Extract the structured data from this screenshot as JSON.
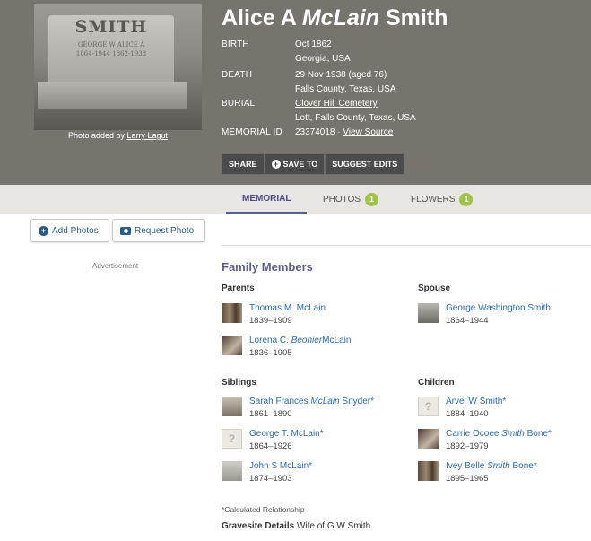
{
  "header": {
    "first_name": "Alice A",
    "middle_name": "McLain",
    "last_name": "Smith",
    "photo_credit_prefix": "Photo added by",
    "photo_credit_user": "Larry Lagut",
    "photo_stone_name": "SMITH",
    "photo_stone_line1": "GEORGE W  ALICE A",
    "photo_stone_line2": "1864-1944  1862-1938"
  },
  "facts": {
    "birth_label": "BIRTH",
    "birth_date": "Oct 1862",
    "birth_place": "Georgia, USA",
    "death_label": "DEATH",
    "death_date": "29 Nov 1938 (aged 76)",
    "death_place": "Falls County, Texas, USA",
    "burial_label": "BURIAL",
    "burial_cemetery": "Clover Hill Cemetery",
    "burial_place": "Lott, Falls County, Texas, USA",
    "memorial_label": "MEMORIAL ID",
    "memorial_id": "23374018",
    "memorial_sep": "·",
    "view_source": "View Source"
  },
  "actions": {
    "share": "SHARE",
    "save_to": "SAVE TO",
    "suggest": "SUGGEST EDITS"
  },
  "tabs": {
    "memorial": "MEMORIAL",
    "photos": "PHOTOS",
    "photos_count": "1",
    "flowers": "FLOWERS",
    "flowers_count": "1"
  },
  "left": {
    "add_photos": "Add Photos",
    "request_photo": "Request Photo",
    "advertisement": "Advertisement"
  },
  "family": {
    "title": "Family Members",
    "parents_label": "Parents",
    "spouse_label": "Spouse",
    "siblings_label": "Siblings",
    "children_label": "Children",
    "parents": [
      {
        "name": "Thomas M. McLain",
        "dates": "1839–1909"
      },
      {
        "name_first": "Lorena C.",
        "name_maiden": "Beonier",
        "name_last": "McLain",
        "dates": "1836–1905"
      }
    ],
    "spouse": [
      {
        "name": "George Washington Smith",
        "dates": "1864–1944"
      }
    ],
    "siblings": [
      {
        "name_first": "Sarah Frances",
        "name_maiden": "McLain",
        "name_last": "Snyder*",
        "dates": "1861–1890"
      },
      {
        "name": "George T. McLain*",
        "dates": "1864–1926"
      },
      {
        "name": "John S McLain*",
        "dates": "1874–1903"
      }
    ],
    "children": [
      {
        "name": "Arvel W Smith*",
        "dates": "1884–1940"
      },
      {
        "name_first": "Carrie Ocoee",
        "name_maiden": "Smith",
        "name_last": "Bone*",
        "dates": "1892–1979"
      },
      {
        "name_first": "Ivey Belle",
        "name_maiden": "Smith",
        "name_last": "Bone*",
        "dates": "1895–1965"
      }
    ],
    "calc_note": "*Calculated Relationship",
    "gravesite_label": "Gravesite Details",
    "gravesite_text": "Wife of G W Smith"
  }
}
